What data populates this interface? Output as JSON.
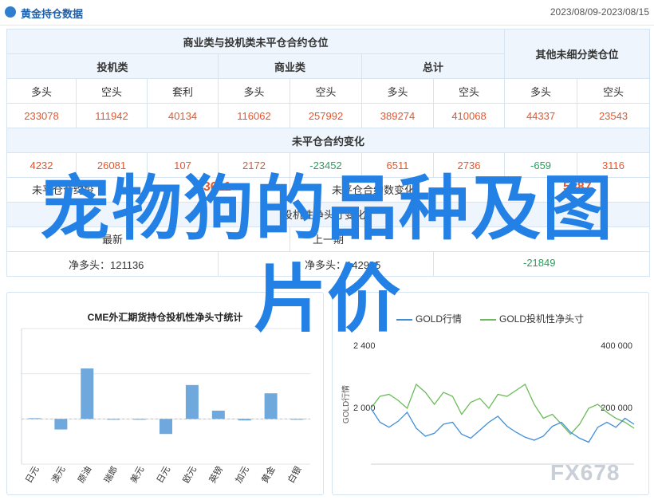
{
  "header": {
    "title": "黄金持仓数据",
    "date_range": "2023/08/09-2023/08/15"
  },
  "table": {
    "group_title": "商业类与投机类未平仓合约仓位",
    "side_title": "其他未细分类仓位",
    "subgroups": [
      "投机类",
      "商业类",
      "总计"
    ],
    "columns": [
      "多头",
      "空头",
      "套利",
      "多头",
      "空头",
      "多头",
      "空头",
      "多头",
      "空头"
    ],
    "values": [
      "233078",
      "111942",
      "40134",
      "116062",
      "257992",
      "389274",
      "410068",
      "44337",
      "23543"
    ],
    "change_title": "未平仓合约变化",
    "changes": [
      "4232",
      "26081",
      "107",
      "2172",
      "-23452",
      "6511",
      "2736",
      "-659",
      "3116"
    ]
  },
  "extra_rows": {
    "row1_left_label": "未平仓合约投",
    "row1_left_value": "43611",
    "row1_right_label": "未平仓合约数变化",
    "row1_right_value": "5887",
    "row2_label": "投机性净头寸变化",
    "row3_left_label": "最新",
    "row3_right_label": "上一期",
    "row4_a": "净多头：121136",
    "row4_b": "净多头：142985",
    "row4_c": "-21849"
  },
  "left_chart": {
    "title": "CME外汇期货持仓投机性净头寸统计",
    "chart_data": {
      "type": "bar",
      "categories": [
        "日元",
        "澳元",
        "原油",
        "瑞郎",
        "美元",
        "日元",
        "欧元",
        "英镑",
        "加元",
        "黄金",
        "白银"
      ],
      "values": [
        1,
        -14,
        67,
        0,
        0,
        -20,
        45,
        11,
        -2,
        34,
        0
      ],
      "ylim": [
        -60,
        120
      ],
      "grid": true
    }
  },
  "right_chart": {
    "legend": [
      "GOLD行情",
      "GOLD投机性净头寸"
    ],
    "left_axis_ticks": [
      "2 400",
      "2 000"
    ],
    "right_axis_ticks": [
      "400 000",
      "200 000"
    ],
    "left_axis_label": "GOLD行情",
    "colors": {
      "price": "#3f8fd8",
      "position": "#6cbb5a"
    },
    "chart_data": {
      "type": "line",
      "series": [
        {
          "name": "GOLD行情",
          "values": [
            2080,
            2010,
            1985,
            2015,
            2060,
            1980,
            1940,
            1955,
            2000,
            2010,
            1950,
            1930,
            1970,
            2010,
            2040,
            1990,
            1960,
            1935,
            1920,
            1940,
            1990,
            2010,
            1960,
            1930,
            1910,
            1985,
            2010,
            1985,
            2030,
            2000
          ]
        },
        {
          "name": "GOLD投机性净头寸",
          "values": [
            240000,
            270000,
            275000,
            260000,
            240000,
            300000,
            280000,
            250000,
            280000,
            270000,
            225000,
            255000,
            265000,
            240000,
            275000,
            270000,
            285000,
            300000,
            250000,
            215000,
            225000,
            200000,
            175000,
            200000,
            240000,
            250000,
            230000,
            215000,
            205000,
            190000
          ]
        }
      ],
      "ylim_left": [
        1800,
        2400
      ],
      "ylim_right": [
        100000,
        400000
      ]
    }
  },
  "overlay": {
    "line1": "宠物狗的品种及图",
    "line2": "片价"
  },
  "watermark": "FX678"
}
